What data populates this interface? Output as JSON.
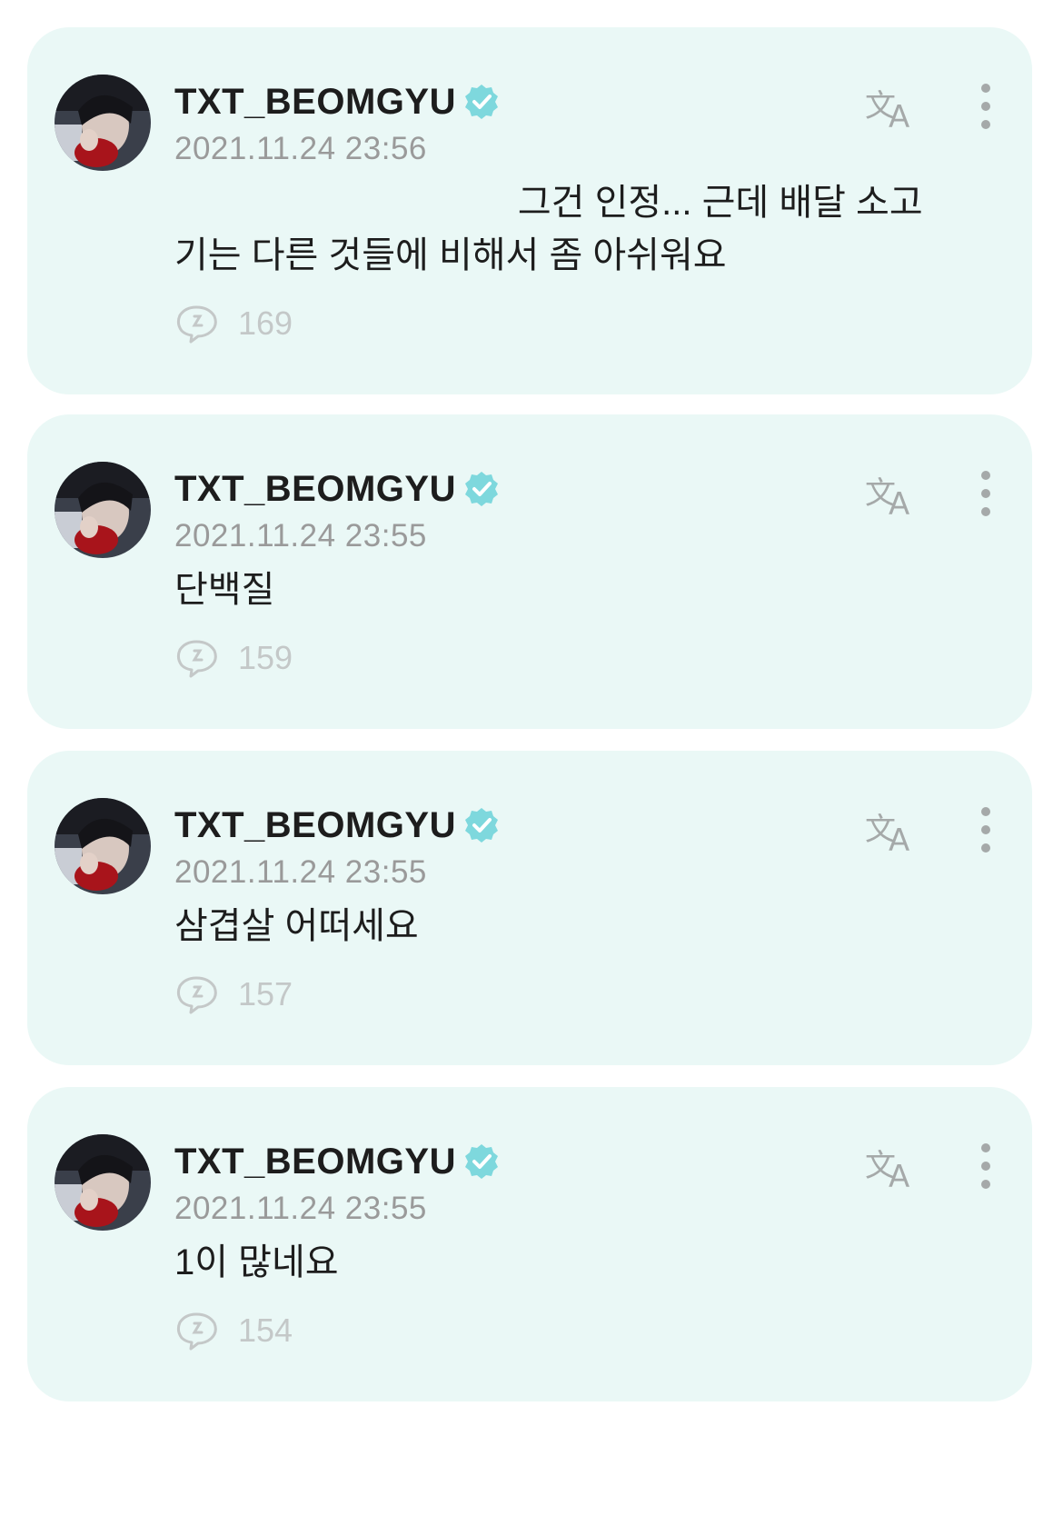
{
  "colors": {
    "card_background": "#eaf8f6",
    "verified_badge": "#7ed8dd",
    "secondary_text": "#9a9a9a",
    "icon_gray": "#a5a9a9"
  },
  "posts": [
    {
      "username": "TXT_BEOMGYU",
      "verified_icon": "verified-badge-icon",
      "timestamp": "2021.11.24 23:56",
      "text": "                                  그건 인정... 근데 배달 소고\n기는 다른 것들에 비해서 좀 아쉬워요",
      "reply_icon": "reply-bubble-icon",
      "reply_count": "169"
    },
    {
      "username": "TXT_BEOMGYU",
      "verified_icon": "verified-badge-icon",
      "timestamp": "2021.11.24 23:55",
      "text": "단백질",
      "reply_icon": "reply-bubble-icon",
      "reply_count": "159"
    },
    {
      "username": "TXT_BEOMGYU",
      "verified_icon": "verified-badge-icon",
      "timestamp": "2021.11.24 23:55",
      "text": "삼겹살 어떠세요",
      "reply_icon": "reply-bubble-icon",
      "reply_count": "157"
    },
    {
      "username": "TXT_BEOMGYU",
      "verified_icon": "verified-badge-icon",
      "timestamp": "2021.11.24 23:55",
      "text": "1이 많네요",
      "reply_icon": "reply-bubble-icon",
      "reply_count": "154"
    }
  ]
}
